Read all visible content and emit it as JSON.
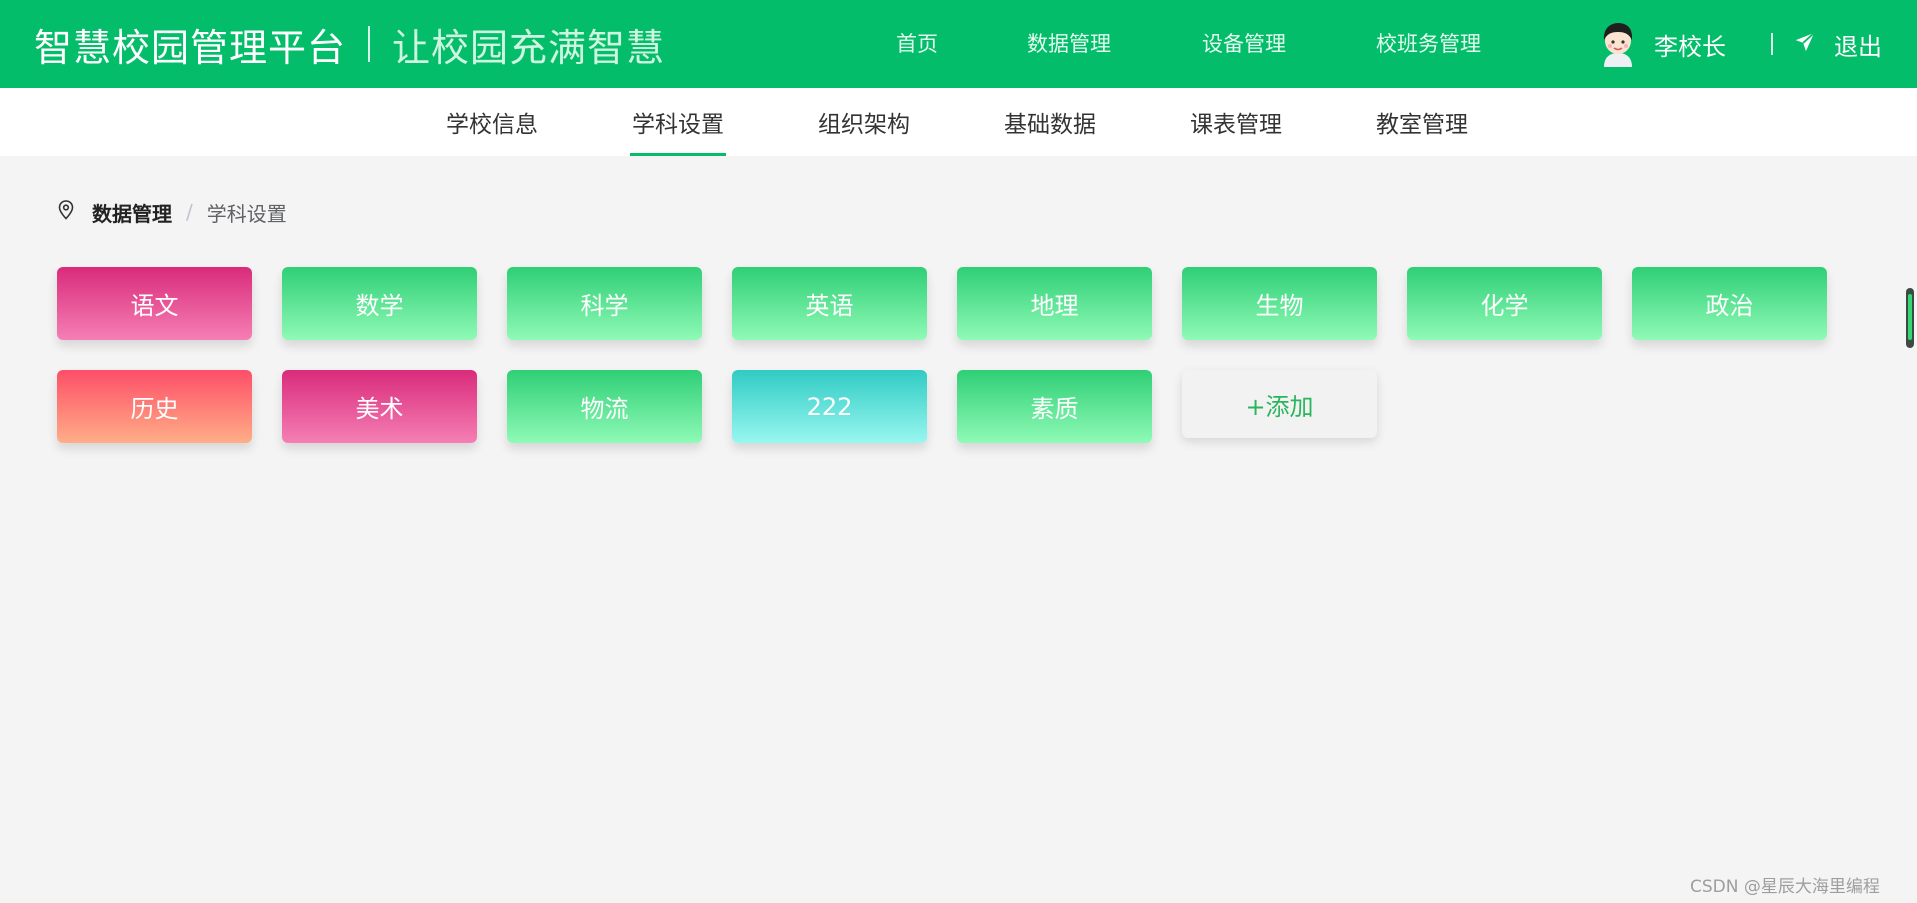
{
  "header": {
    "title": "智慧校园管理平台",
    "slogan": "让校园充满智慧",
    "nav": [
      "首页",
      "数据管理",
      "设备管理",
      "校班务管理"
    ],
    "user_name": "李校长",
    "logout_label": "退出"
  },
  "subnav": {
    "tabs": [
      "学校信息",
      "学科设置",
      "组织架构",
      "基础数据",
      "课表管理",
      "教室管理"
    ],
    "active": "学科设置"
  },
  "breadcrumb": {
    "first": "数据管理",
    "separator": "/",
    "current": "学科设置"
  },
  "subjects": [
    {
      "name": "语文",
      "style": "pink"
    },
    {
      "name": "数学",
      "style": "green"
    },
    {
      "name": "科学",
      "style": "green"
    },
    {
      "name": "英语",
      "style": "green"
    },
    {
      "name": "地理",
      "style": "green"
    },
    {
      "name": "生物",
      "style": "green"
    },
    {
      "name": "化学",
      "style": "green"
    },
    {
      "name": "政治",
      "style": "green"
    },
    {
      "name": "历史",
      "style": "coral"
    },
    {
      "name": "美术",
      "style": "pink"
    },
    {
      "name": "物流",
      "style": "green"
    },
    {
      "name": "222",
      "style": "teal"
    },
    {
      "name": "素质",
      "style": "green"
    }
  ],
  "add_label": "+添加",
  "watermark": "CSDN @星辰大海里编程",
  "colors": {
    "primary": "#04bd6a",
    "page_bg": "#f4f4f4"
  }
}
